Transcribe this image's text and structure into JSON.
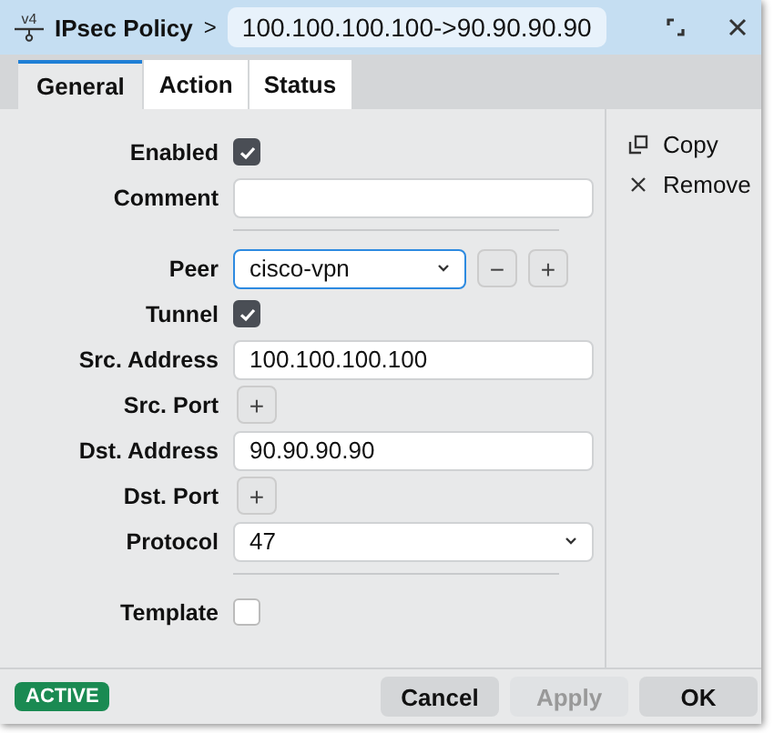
{
  "window": {
    "icon_label": "v4",
    "title": "IPsec Policy",
    "breadcrumb_separator": ">",
    "subtitle": "100.100.100.100->90.90.90.90"
  },
  "tabs": [
    {
      "label": "General",
      "selected": true
    },
    {
      "label": "Action",
      "selected": false
    },
    {
      "label": "Status",
      "selected": false
    }
  ],
  "fields": [
    {
      "kind": "checkbox",
      "label": "Enabled",
      "checked": true
    },
    {
      "kind": "text",
      "label": "Comment"
    },
    {
      "kind": "separator"
    },
    {
      "kind": "select",
      "label": "Peer",
      "value": "cisco-vpn",
      "focused": true,
      "buttons": [
        "−",
        "+"
      ]
    },
    {
      "kind": "checkbox",
      "label": "Tunnel",
      "checked": true
    },
    {
      "kind": "text",
      "label": "Src. Address",
      "value": "100.100.100.100"
    },
    {
      "kind": "add",
      "label": "Src. Port",
      "button": "+"
    },
    {
      "kind": "text",
      "label": "Dst. Address",
      "value": "90.90.90.90"
    },
    {
      "kind": "add",
      "label": "Dst. Port",
      "button": "+"
    },
    {
      "kind": "select",
      "label": "Protocol",
      "value": "47",
      "focused": false
    },
    {
      "kind": "separator"
    },
    {
      "kind": "checkbox",
      "label": "Template",
      "checked": false
    }
  ],
  "side_actions": [
    {
      "kind": "copy",
      "label": "Copy"
    },
    {
      "kind": "remove",
      "label": "Remove"
    }
  ],
  "status_badge": "ACTIVE",
  "buttons": [
    {
      "label": "Cancel",
      "disabled": false
    },
    {
      "label": "Apply",
      "disabled": true
    },
    {
      "label": "OK",
      "disabled": false
    }
  ]
}
